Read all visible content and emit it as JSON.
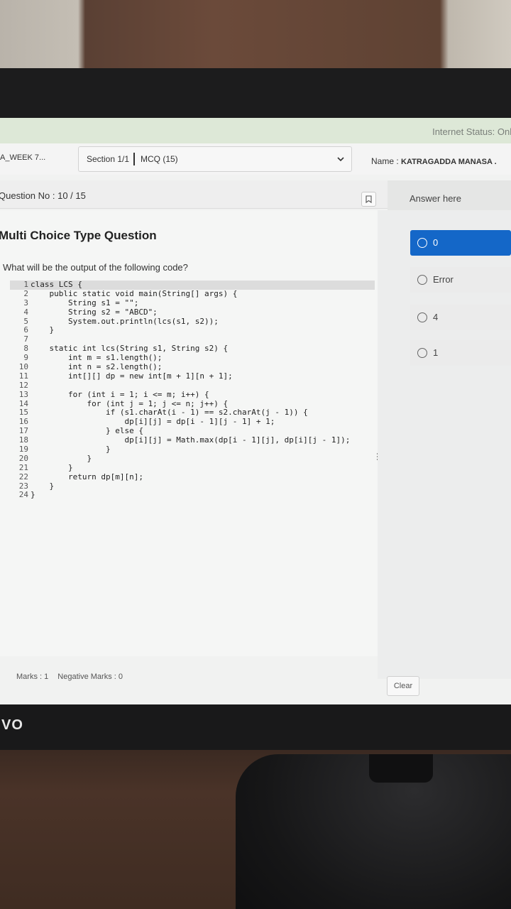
{
  "status": {
    "internet": "Internet Status: Onli"
  },
  "header": {
    "course": "A_WEEK 7...",
    "section": {
      "label": "Section 1/1",
      "mcq": "MCQ (15)"
    },
    "name_label": "Name :",
    "name_value": "KATRAGADDA MANASA ."
  },
  "question": {
    "number": "Question No : 10 / 15",
    "type": "Multi Choice Type Question",
    "text": "What will be the output of the following code?",
    "code": [
      {
        "n": "1",
        "text": "class LCS {"
      },
      {
        "n": "2",
        "text": "    public static void main(String[] args) {"
      },
      {
        "n": "3",
        "text": "        String s1 = \"\";"
      },
      {
        "n": "4",
        "text": "        String s2 = \"ABCD\";"
      },
      {
        "n": "5",
        "text": "        System.out.println(lcs(s1, s2));"
      },
      {
        "n": "6",
        "text": "    }"
      },
      {
        "n": "7",
        "text": ""
      },
      {
        "n": "8",
        "text": "    static int lcs(String s1, String s2) {"
      },
      {
        "n": "9",
        "text": "        int m = s1.length();"
      },
      {
        "n": "10",
        "text": "        int n = s2.length();"
      },
      {
        "n": "11",
        "text": "        int[][] dp = new int[m + 1][n + 1];"
      },
      {
        "n": "12",
        "text": ""
      },
      {
        "n": "13",
        "text": "        for (int i = 1; i <= m; i++) {"
      },
      {
        "n": "14",
        "text": "            for (int j = 1; j <= n; j++) {"
      },
      {
        "n": "15",
        "text": "                if (s1.charAt(i - 1) == s2.charAt(j - 1)) {"
      },
      {
        "n": "16",
        "text": "                    dp[i][j] = dp[i - 1][j - 1] + 1;"
      },
      {
        "n": "17",
        "text": "                } else {"
      },
      {
        "n": "18",
        "text": "                    dp[i][j] = Math.max(dp[i - 1][j], dp[i][j - 1]);"
      },
      {
        "n": "19",
        "text": "                }"
      },
      {
        "n": "20",
        "text": "            }"
      },
      {
        "n": "21",
        "text": "        }"
      },
      {
        "n": "22",
        "text": "        return dp[m][n];"
      },
      {
        "n": "23",
        "text": "    }"
      },
      {
        "n": "24",
        "text": "}"
      }
    ],
    "marks": "Marks : 1",
    "negative_marks": "Negative Marks : 0"
  },
  "answer": {
    "title": "Answer here",
    "options": [
      {
        "label": "0",
        "selected": true
      },
      {
        "label": "Error",
        "selected": false
      },
      {
        "label": "4",
        "selected": false
      },
      {
        "label": "1",
        "selected": false
      }
    ],
    "clear_label": "Clear"
  },
  "device": {
    "brand": "VO"
  },
  "colors": {
    "accent": "#1467c8",
    "status_bar": "#dde8d7"
  }
}
